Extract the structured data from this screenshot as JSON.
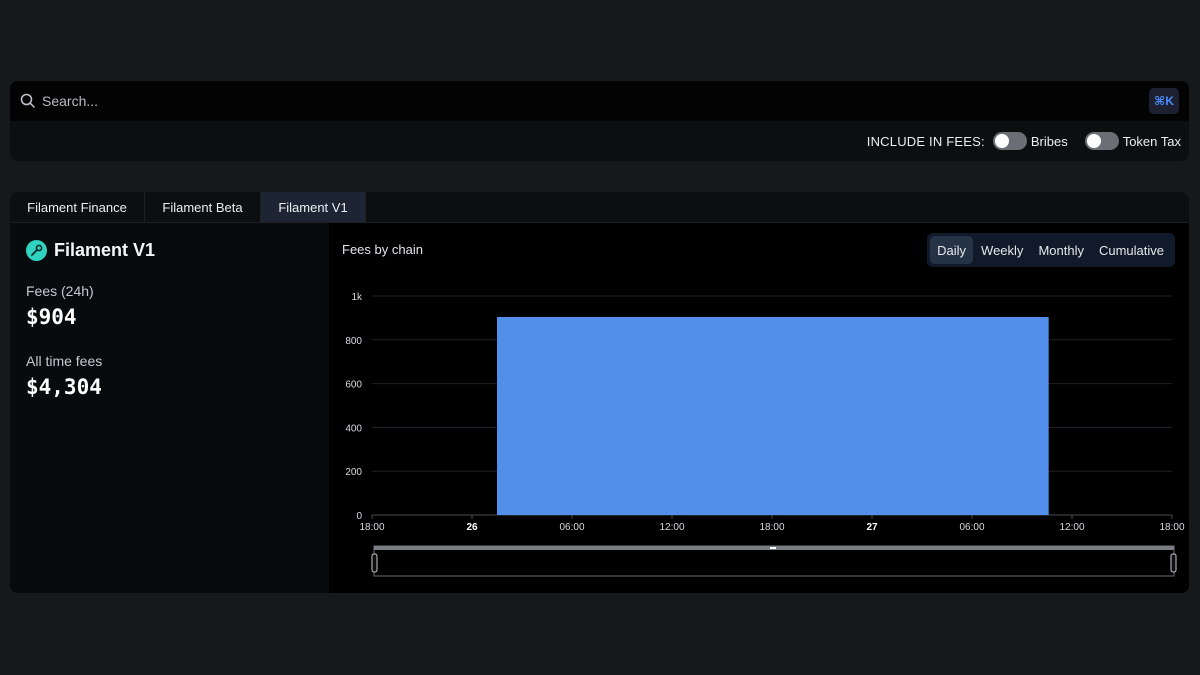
{
  "search": {
    "placeholder": "Search...",
    "shortcut": "⌘K"
  },
  "fees_options": {
    "label": "INCLUDE IN FEES:",
    "toggles": [
      {
        "label": "Bribes",
        "on": false
      },
      {
        "label": "Token Tax",
        "on": false
      }
    ]
  },
  "tabs": [
    {
      "label": "Filament Finance",
      "active": false
    },
    {
      "label": "Filament Beta",
      "active": false
    },
    {
      "label": "Filament V1",
      "active": true
    }
  ],
  "protocol": {
    "name": "Filament V1",
    "logo_color": "#2fd3c0",
    "stats": [
      {
        "label": "Fees (24h)",
        "value": "$904"
      },
      {
        "label": "All time fees",
        "value": "$4,304"
      }
    ]
  },
  "chart_panel": {
    "title": "Fees by chain",
    "periods": [
      {
        "label": "Daily",
        "active": true
      },
      {
        "label": "Weekly",
        "active": false
      },
      {
        "label": "Monthly",
        "active": false
      },
      {
        "label": "Cumulative",
        "active": false
      }
    ]
  },
  "chart_data": {
    "type": "area",
    "title": "Fees by chain",
    "xlabel": "",
    "ylabel": "",
    "x_ticks": [
      {
        "label": "18:00",
        "bold": false
      },
      {
        "label": "26",
        "bold": true
      },
      {
        "label": "06:00",
        "bold": false
      },
      {
        "label": "12:00",
        "bold": false
      },
      {
        "label": "18:00",
        "bold": false
      },
      {
        "label": "27",
        "bold": true
      },
      {
        "label": "06:00",
        "bold": false
      },
      {
        "label": "12:00",
        "bold": false
      },
      {
        "label": "18:00",
        "bold": false
      }
    ],
    "x_range_hours": [
      0,
      48
    ],
    "y_ticks": [
      {
        "value": 0,
        "label": "0"
      },
      {
        "value": 200,
        "label": "200"
      },
      {
        "value": 400,
        "label": "400"
      },
      {
        "value": 600,
        "label": "600"
      },
      {
        "value": 800,
        "label": "800"
      },
      {
        "value": 1000,
        "label": "1k"
      }
    ],
    "ylim": [
      0,
      1000
    ],
    "grid": true,
    "series": [
      {
        "color": "#528fea",
        "points": [
          {
            "x": 7.5,
            "y": 904
          },
          {
            "x": 40.6,
            "y": 904
          }
        ]
      }
    ]
  }
}
